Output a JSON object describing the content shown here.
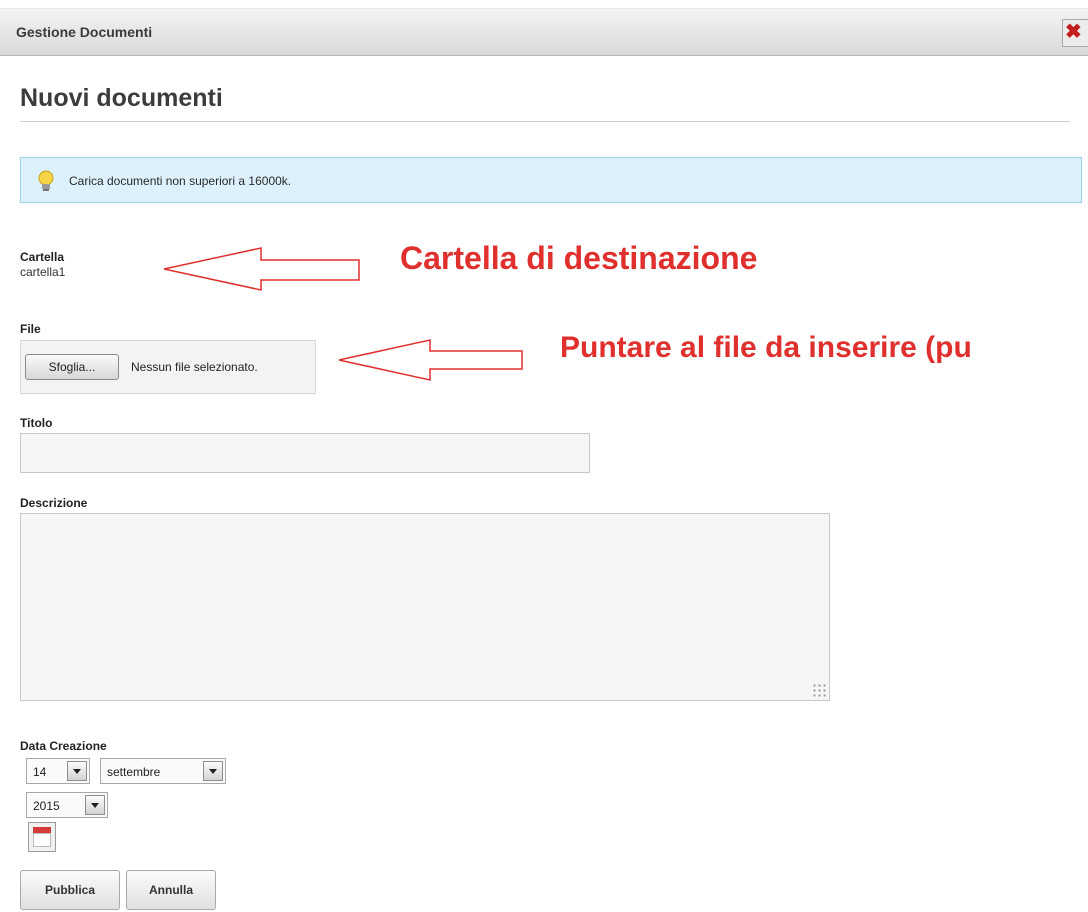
{
  "window": {
    "title": "Gestione Documenti",
    "close_glyph": "✖"
  },
  "page": {
    "title": "Nuovi documenti"
  },
  "info": {
    "icon": "lightbulb-icon",
    "text": "Carica documenti non superiori a 16000k."
  },
  "folder": {
    "label": "Cartella",
    "value": "cartella1"
  },
  "file": {
    "label": "File",
    "browse_label": "Sfoglia...",
    "status": "Nessun file selezionato."
  },
  "title_field": {
    "label": "Titolo",
    "value": ""
  },
  "description_field": {
    "label": "Descrizione",
    "value": ""
  },
  "date": {
    "label": "Data Creazione",
    "day": "14",
    "month": "settembre",
    "year": "2015",
    "calendar_icon": "calendar-icon"
  },
  "actions": {
    "publish_label": "Pubblica",
    "cancel_label": "Annulla"
  },
  "annotations": {
    "folder_note": "Cartella di destinazione",
    "file_note": "Puntare al file da inserire (pu",
    "color": "#e0302e"
  }
}
